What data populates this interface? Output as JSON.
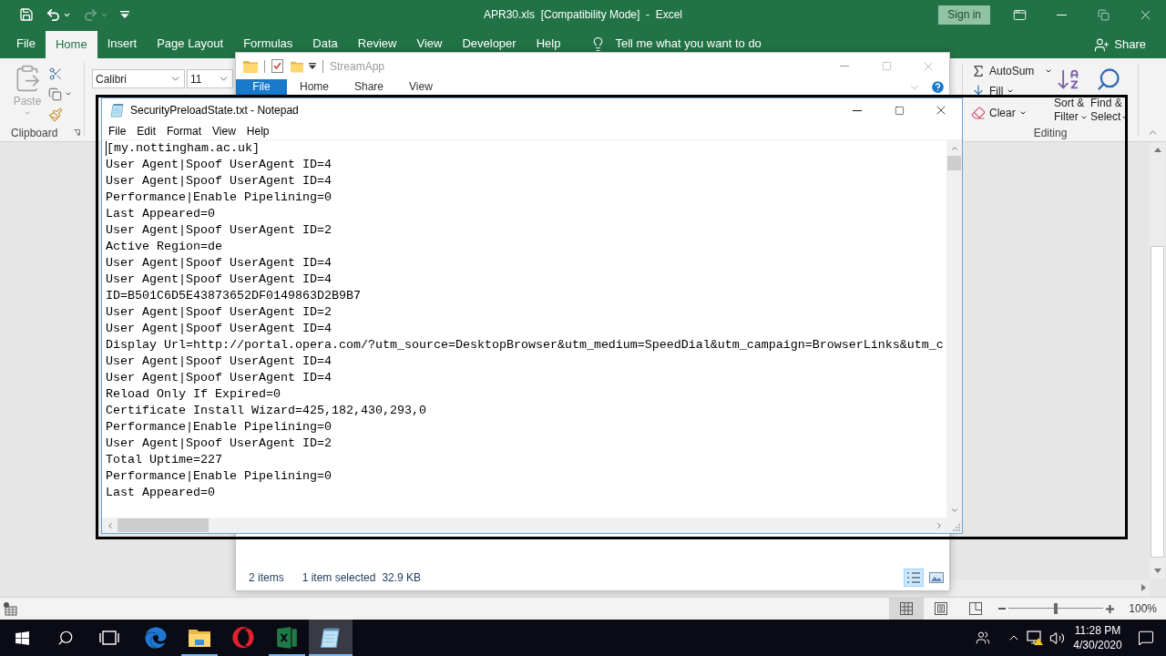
{
  "excel": {
    "quick_access": [
      {
        "kind": "save",
        "disabled": false
      },
      {
        "kind": "undo",
        "disabled": false
      },
      {
        "kind": "redo",
        "disabled": true
      },
      {
        "kind": "customize",
        "disabled": false
      }
    ],
    "title": "APR30.xls  [Compatibility Mode]  -  Excel",
    "sign_in": "Sign in",
    "tabs": [
      {
        "label": "File",
        "selected": false
      },
      {
        "label": "Home",
        "selected": true
      },
      {
        "label": "Insert",
        "selected": false
      },
      {
        "label": "Page Layout",
        "selected": false
      },
      {
        "label": "Formulas",
        "selected": false
      },
      {
        "label": "Data",
        "selected": false
      },
      {
        "label": "Review",
        "selected": false
      },
      {
        "label": "View",
        "selected": false
      },
      {
        "label": "Developer",
        "selected": false
      },
      {
        "label": "Help",
        "selected": false
      }
    ],
    "tell_me": {
      "placeholder": "Tell me what you want to do"
    },
    "share": "Share",
    "clipboard": {
      "paste": "Paste",
      "paste_disabled": true,
      "label": "Clipboard"
    },
    "font": {
      "name": "Calibri",
      "size": "11"
    },
    "editing": {
      "autosum": "AutoSum",
      "fill": "Fill",
      "clear": "Clear",
      "sort_filter": "Sort & Filter",
      "find_select": "Find & Select",
      "label": "Editing"
    },
    "status_bar": {
      "views": [
        {
          "kind": "normal",
          "selected": true
        },
        {
          "kind": "page_layout",
          "selected": false
        },
        {
          "kind": "page_break",
          "selected": false
        }
      ],
      "zoom_slider": {
        "level": 0.5
      },
      "zoom": "100%"
    }
  },
  "explorer": {
    "title": "StreamApp",
    "tabs": [
      {
        "label": "File",
        "selected": true
      },
      {
        "label": "Home",
        "selected": false
      },
      {
        "label": "Share",
        "selected": false
      },
      {
        "label": "View",
        "selected": false
      }
    ],
    "status": {
      "items": "2 items",
      "selected": "1 item selected",
      "size": "32.9 KB"
    },
    "views": [
      {
        "kind": "details",
        "selected": true
      },
      {
        "kind": "large_icons",
        "selected": false
      }
    ]
  },
  "notepad": {
    "title": "SecurityPreloadState.txt - Notepad",
    "menu": [
      "File",
      "Edit",
      "Format",
      "View",
      "Help"
    ],
    "lines": [
      "[my.nottingham.ac.uk]",
      "User Agent|Spoof UserAgent ID=4",
      "User Agent|Spoof UserAgent ID=4",
      "Performance|Enable Pipelining=0",
      "Last Appeared=0",
      "User Agent|Spoof UserAgent ID=2",
      "Active Region=de",
      "User Agent|Spoof UserAgent ID=4",
      "User Agent|Spoof UserAgent ID=4",
      "ID=B501C6D5E43873652DF0149863D2B9B7",
      "User Agent|Spoof UserAgent ID=2",
      "User Agent|Spoof UserAgent ID=4",
      "Display Url=http://portal.opera.com/?utm_source=DesktopBrowser&utm_medium=SpeedDial&utm_campaign=BrowserLinks&utm_c",
      "User Agent|Spoof UserAgent ID=4",
      "User Agent|Spoof UserAgent ID=4",
      "Reload Only If Expired=0",
      "Certificate Install Wizard=425,182,430,293,0",
      "Performance|Enable Pipelining=0",
      "User Agent|Spoof UserAgent ID=2",
      "Total Uptime=227",
      "Performance|Enable Pipelining=0",
      "Last Appeared=0"
    ]
  },
  "taskbar": {
    "apps": [
      {
        "kind": "edge",
        "running": false,
        "active": false
      },
      {
        "kind": "explorer",
        "running": true,
        "active": false
      },
      {
        "kind": "opera",
        "running": false,
        "active": false
      },
      {
        "kind": "excel",
        "running": true,
        "active": false
      },
      {
        "kind": "notepad",
        "running": true,
        "active": true
      }
    ],
    "time": "11:28 PM",
    "date": "4/30/2020"
  }
}
